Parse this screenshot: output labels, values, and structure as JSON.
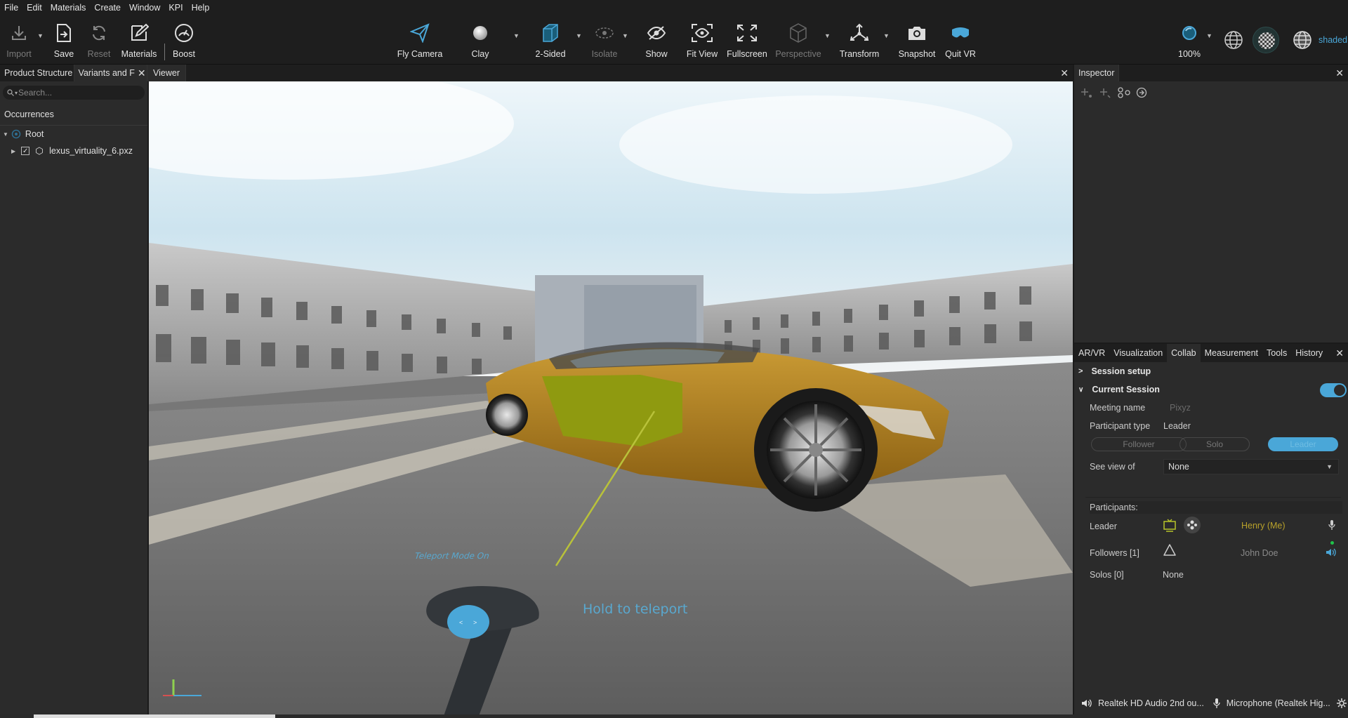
{
  "menu": [
    "File",
    "Edit",
    "Materials",
    "Create",
    "Window",
    "KPI",
    "Help"
  ],
  "toolbar": {
    "left": [
      {
        "label": "Import",
        "icon": "import-icon",
        "enabled": false
      },
      {
        "label": "Save",
        "icon": "save-icon",
        "enabled": true
      },
      {
        "label": "Reset",
        "icon": "reset-icon",
        "enabled": false
      },
      {
        "label": "Materials",
        "icon": "materials-icon",
        "enabled": true
      },
      {
        "label": "Boost",
        "icon": "boost-icon",
        "enabled": true
      }
    ],
    "center": [
      {
        "label": "Fly Camera",
        "icon": "fly-camera-icon",
        "enabled": true
      },
      {
        "label": "Clay",
        "icon": "clay-icon",
        "enabled": true
      },
      {
        "label": "2-Sided",
        "icon": "two-sided-icon",
        "enabled": true
      },
      {
        "label": "Isolate",
        "icon": "isolate-icon",
        "enabled": false
      },
      {
        "label": "Show",
        "icon": "show-icon",
        "enabled": true
      },
      {
        "label": "Fit View",
        "icon": "fit-view-icon",
        "enabled": true
      },
      {
        "label": "Fullscreen",
        "icon": "fullscreen-icon",
        "enabled": true
      },
      {
        "label": "Perspective",
        "icon": "perspective-icon",
        "enabled": false
      },
      {
        "label": "Transform",
        "icon": "transform-icon",
        "enabled": true
      },
      {
        "label": "Snapshot",
        "icon": "snapshot-icon",
        "enabled": true
      },
      {
        "label": "Quit VR",
        "icon": "quit-vr-icon",
        "enabled": true
      }
    ],
    "zoom": "100%",
    "shading_mode": "shaded"
  },
  "left_panel": {
    "tabs": [
      "Product Structure",
      "Variants and F"
    ],
    "search_placeholder": "Search...",
    "section": "Occurrences",
    "root_label": "Root",
    "file_label": "lexus_virtuality_6.pxz"
  },
  "viewer": {
    "tab": "Viewer",
    "teleport_mode": "Teleport Mode On",
    "teleport_hint": "Hold to teleport"
  },
  "inspector": {
    "title": "Inspector"
  },
  "right_tabs": [
    "AR/VR",
    "Visualization",
    "Collab",
    "Measurement",
    "Tools",
    "History"
  ],
  "collab": {
    "session_setup": "Session setup",
    "current_session": "Current Session",
    "meeting_name_label": "Meeting name",
    "meeting_name_value": "Pixyz",
    "participant_type_label": "Participant type",
    "participant_type_value": "Leader",
    "mode_buttons": [
      "Follower",
      "Solo",
      "Leader"
    ],
    "see_view_label": "See view of",
    "see_view_value": "None",
    "participants_header": "Participants:",
    "leader_label": "Leader",
    "leader_name": "Henry (Me)",
    "followers_label": "Followers [1]",
    "follower_name": "John Doe",
    "solos_label": "Solos [0]",
    "solos_value": "None"
  },
  "audio": {
    "speaker": "Realtek HD Audio 2nd ou...",
    "microphone": "Microphone (Realtek Hig..."
  },
  "colors": {
    "accent": "#4aa7d8",
    "leader_name": "#b8a12a",
    "door_green": "#8f9a10",
    "car_gold": "#b07d18"
  }
}
